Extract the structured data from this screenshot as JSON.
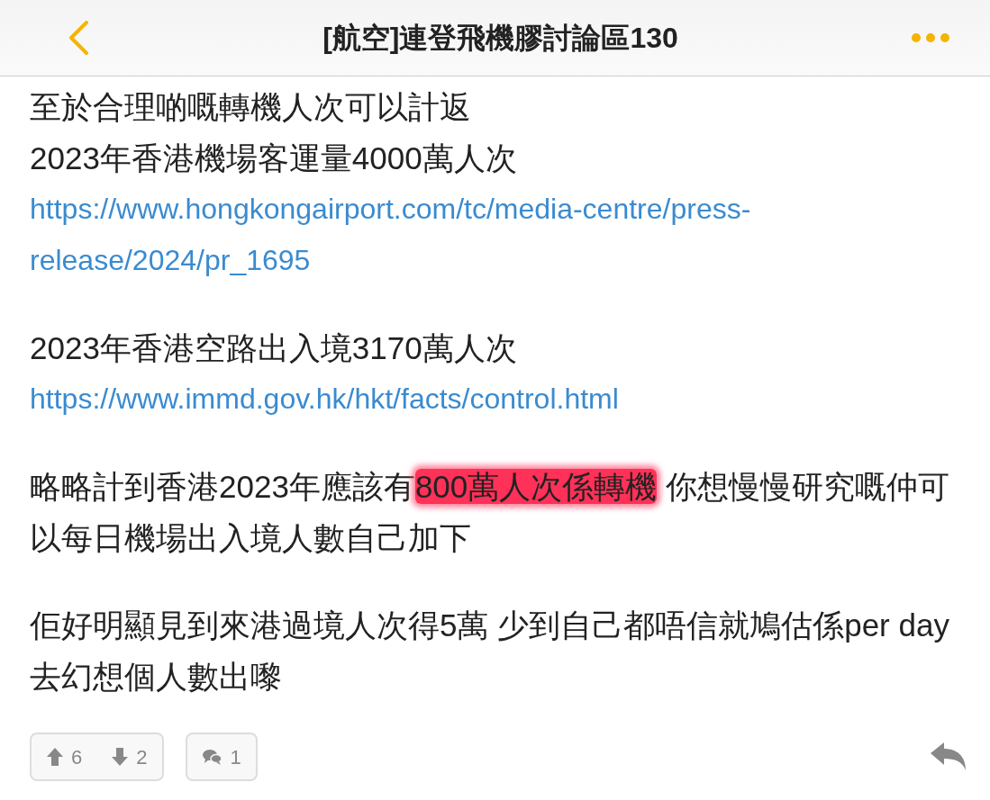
{
  "header": {
    "title": "[航空]連登飛機膠討論區130"
  },
  "paragraphs": [
    [
      {
        "kind": "text",
        "lines": [
          "至於合理啲嘅轉機人次可以計返",
          "2023年香港機場客運量4000萬人次"
        ]
      },
      {
        "kind": "link",
        "lines": [
          "https://www.hongkongairport.com/tc/media-centre/press-",
          "release/2024/pr_1695"
        ]
      }
    ],
    [
      {
        "kind": "text",
        "lines": [
          "2023年香港空路出入境3170萬人次"
        ]
      },
      {
        "kind": "link",
        "lines": [
          "https://www.immd.gov.hk/hkt/facts/control.html"
        ]
      }
    ],
    [
      {
        "kind": "text",
        "lines": [
          [
            {
              "text": "略略計到香港2023年應該有",
              "highlighted": false
            },
            {
              "text": "800萬人次係轉機",
              "highlighted": true
            },
            {
              "text": " 你想慢慢研究嘅仲可",
              "highlighted": false
            }
          ],
          "以每日機場出入境人數自己加下"
        ]
      }
    ],
    [
      {
        "kind": "text",
        "lines": [
          "佢好明顯見到來港過境人次得5萬 少到自己都唔信就鳩估係per day",
          "去幻想個人數出嚟"
        ]
      }
    ]
  ],
  "footer": {
    "upvotes": "6",
    "downvotes": "2",
    "comments": "1"
  }
}
